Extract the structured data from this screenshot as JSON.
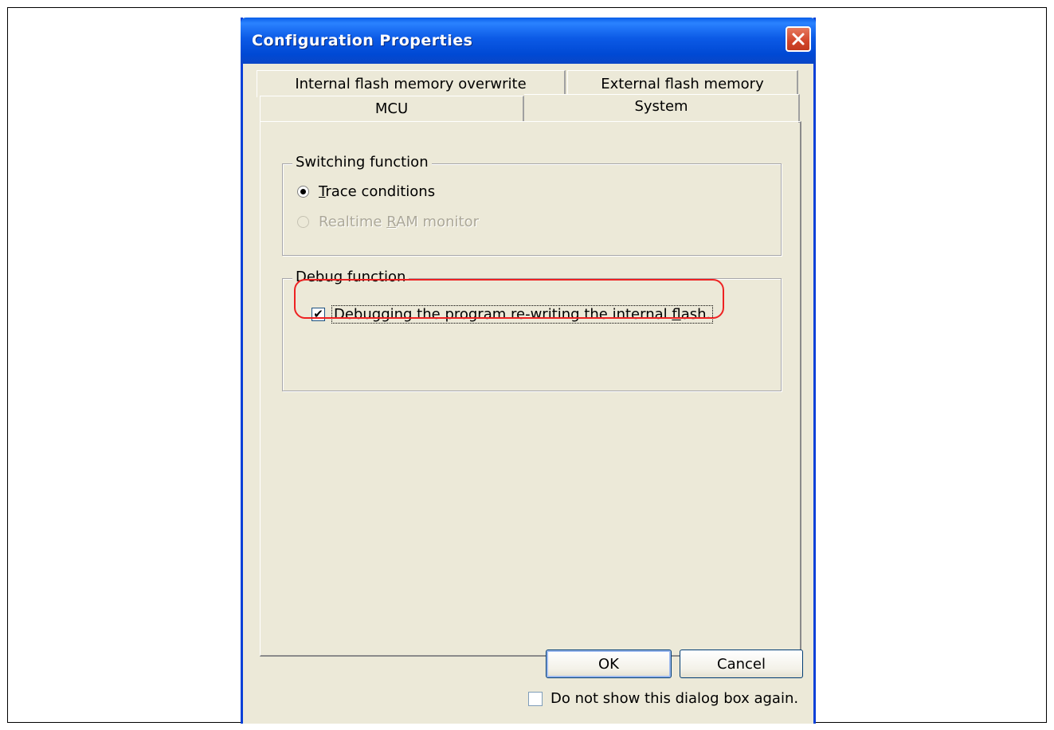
{
  "window": {
    "title": "Configuration Properties",
    "close_icon": "close-icon"
  },
  "tabs": [
    {
      "label": "Internal flash memory overwrite",
      "selected": false
    },
    {
      "label": "External flash memory",
      "selected": false
    },
    {
      "label": "MCU",
      "selected": false
    },
    {
      "label": "System",
      "selected": true
    }
  ],
  "switching_group": {
    "legend": "Switching function",
    "options": [
      {
        "label_pre": "",
        "mnemonic": "T",
        "label_post": "race conditions",
        "selected": true,
        "enabled": true
      },
      {
        "label_pre": "Realtime ",
        "mnemonic": "R",
        "label_post": "AM monitor",
        "selected": false,
        "enabled": false
      }
    ]
  },
  "debug_group": {
    "legend": "Debug function",
    "checkbox": {
      "label_pre": "Debugging the program re-writing the internal ",
      "mnemonic": "f",
      "label_post": "lash.",
      "checked": true
    }
  },
  "buttons": {
    "ok": "OK",
    "cancel": "Cancel"
  },
  "footer": {
    "dont_show_label": "Do not show this dialog box again.",
    "checked": false
  },
  "colors": {
    "titlebar": "#0a5ee8",
    "highlight": "#ee2222",
    "dialog_bg": "#ece9d8"
  }
}
